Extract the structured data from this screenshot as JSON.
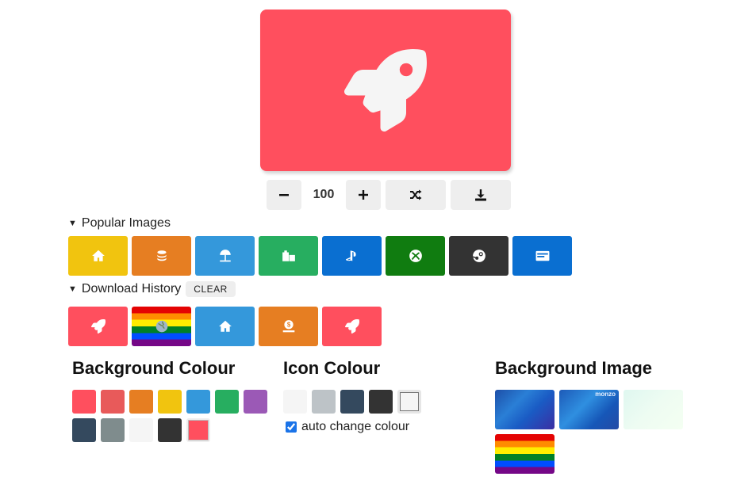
{
  "preview": {
    "bg": "#ff4f5e",
    "icon": "rocket-icon",
    "icon_color": "#f5f5f5"
  },
  "controls": {
    "zoom_value": "100",
    "minus_label": "−",
    "plus_label": "+",
    "shuffle_icon": "shuffle-icon",
    "download_icon": "download-icon"
  },
  "popular": {
    "label": "Popular Images",
    "tiles": [
      {
        "icon": "home-icon",
        "bg": "#f1c40f"
      },
      {
        "icon": "coins-icon",
        "bg": "#e67e22"
      },
      {
        "icon": "beach-umbrella-icon",
        "bg": "#3498db"
      },
      {
        "icon": "gifts-icon",
        "bg": "#27ae60"
      },
      {
        "icon": "playstation-icon",
        "bg": "#0a6fd1"
      },
      {
        "icon": "xbox-icon",
        "bg": "#107c10"
      },
      {
        "icon": "steam-icon",
        "bg": "#333333"
      },
      {
        "icon": "amex-icon",
        "bg": "#0a6fd1"
      }
    ]
  },
  "history": {
    "label": "Download History",
    "clear_label": "CLEAR",
    "tiles": [
      {
        "icon": "rocket-icon",
        "bg": "#ff4f5e"
      },
      {
        "icon": "globe-icon",
        "bg": "rainbow"
      },
      {
        "icon": "home-icon",
        "bg": "#3498db"
      },
      {
        "icon": "money-icon",
        "bg": "#e67e22"
      },
      {
        "icon": "rocket-icon",
        "bg": "#ff4f5e"
      }
    ]
  },
  "background_colour": {
    "title": "Background Colour",
    "swatches": [
      "#ff4f5e",
      "#e85a5a",
      "#e67e22",
      "#f1c40f",
      "#3498db",
      "#27ae60",
      "#9b59b6",
      "#34495e",
      "#7f8c8d",
      "#f5f5f5",
      "#333333",
      "#ff4f5e"
    ]
  },
  "icon_colour": {
    "title": "Icon Colour",
    "swatches": [
      "#f5f5f5",
      "#bdc3c7",
      "#34495e",
      "#333333",
      "#f5f5f5"
    ],
    "auto_change_label": "auto change colour",
    "auto_change_checked": true
  },
  "background_image": {
    "title": "Background Image",
    "images": [
      {
        "name": "blue-gradient"
      },
      {
        "name": "monzo-blue",
        "tag": "monzo"
      },
      {
        "name": "mint-gradient"
      },
      {
        "name": "rainbow-flag"
      }
    ]
  }
}
